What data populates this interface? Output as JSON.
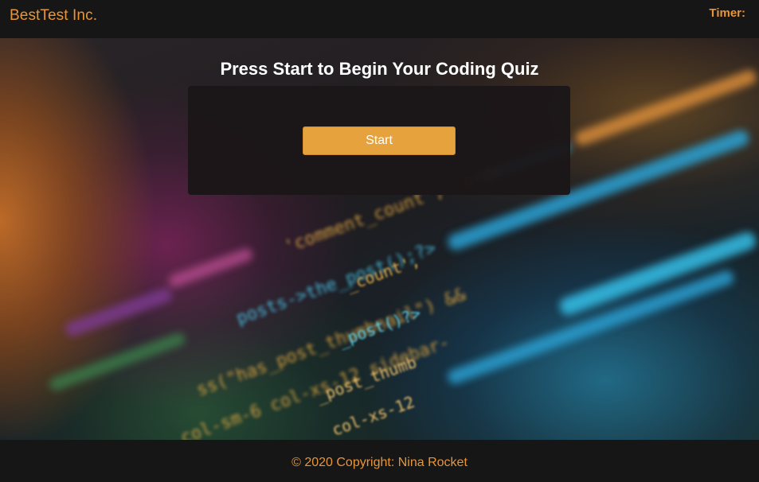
{
  "header": {
    "brand": "BestTest Inc.",
    "timer_label": "Timer:",
    "timer_value": ""
  },
  "main": {
    "title": "Press Start to Begin Your Coding Quiz",
    "start_label": "Start"
  },
  "footer": {
    "copyright": "© 2020 Copyright: Nina Rocket"
  },
  "colors": {
    "accent": "#e8953a",
    "button": "#e6a33d",
    "bar_background": "#161616",
    "panel_background": "#1b1618"
  }
}
